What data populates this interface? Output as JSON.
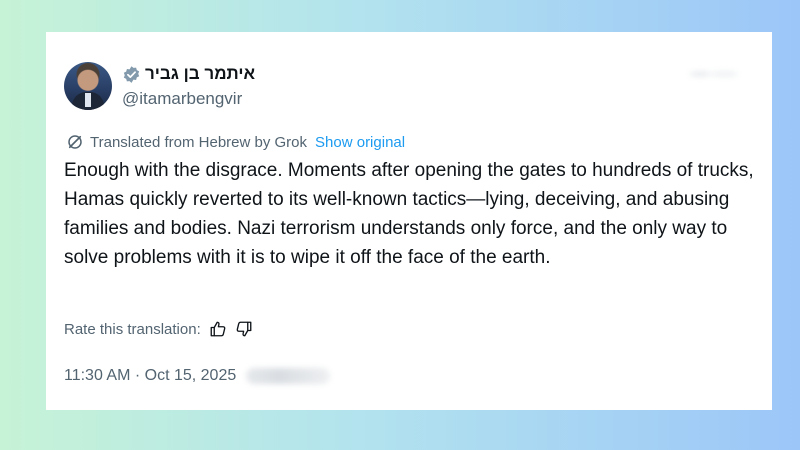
{
  "post": {
    "display_name": "איתמר בן גביר",
    "handle": "@itamarbengvir",
    "verified_icon": "verified-badge-icon",
    "translation_notice": "Translated from Hebrew by Grok",
    "show_original_label": "Show original",
    "text": "Enough with the disgrace. Moments after opening the gates to hundreds of trucks, Hamas quickly reverted to its well-known tactics—lying, deceiving, and abusing families and bodies. Nazi terrorism understands only force, and the only way to solve problems with it is to wipe it off the face of the earth.",
    "rate_label": "Rate this translation:",
    "timestamp": "11:30 AM · Oct 15, 2025"
  },
  "colors": {
    "text_primary": "#0f1419",
    "text_secondary": "#536471",
    "link": "#1d9bf0",
    "verified_badge": "#829aab"
  }
}
